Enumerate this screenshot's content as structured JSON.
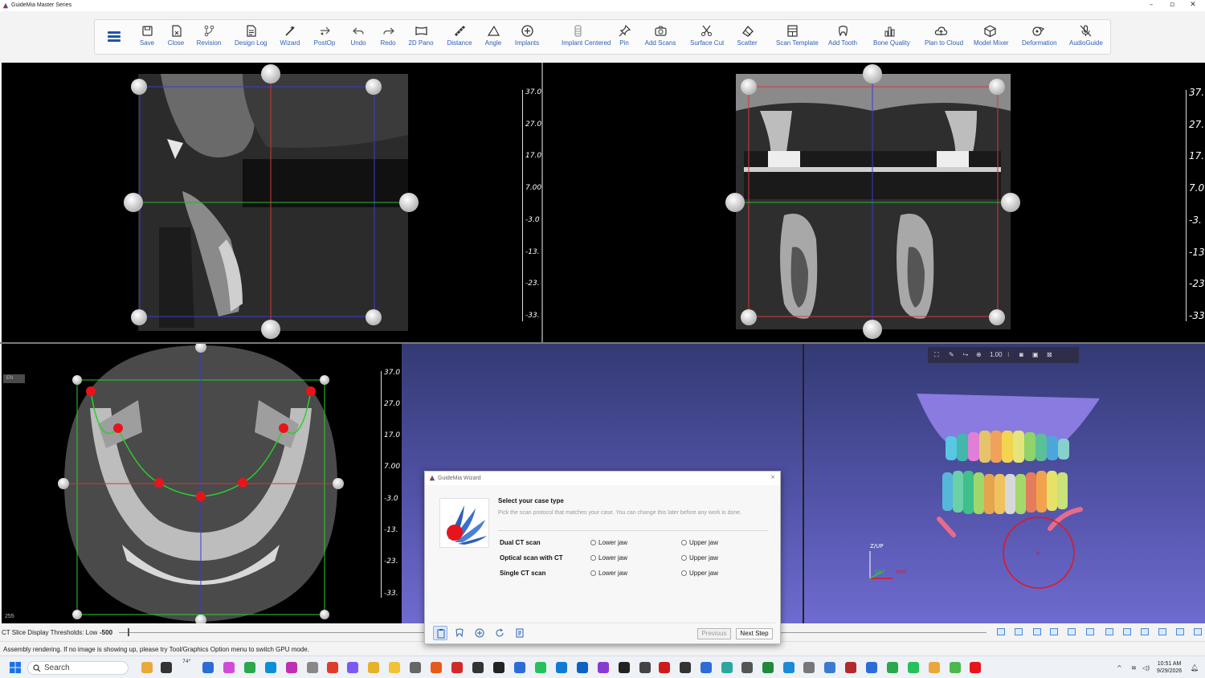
{
  "window": {
    "title": "GuideMia Master Series",
    "controls": [
      "–",
      "▫",
      "✕"
    ]
  },
  "toolbar": {
    "items": [
      {
        "label": "Save",
        "icon": "save-icon"
      },
      {
        "label": "Close",
        "icon": "close-file-icon"
      },
      {
        "label": "Revision",
        "icon": "revision-icon"
      },
      {
        "label": "Design Log",
        "icon": "design-log-icon"
      },
      {
        "label": "Wizard",
        "icon": "wizard-icon"
      },
      {
        "label": "PostOp",
        "icon": "postop-icon"
      },
      {
        "label": "Undo",
        "icon": "undo-icon"
      },
      {
        "label": "Redo",
        "icon": "redo-icon"
      },
      {
        "label": "2D Pano",
        "icon": "pano-icon"
      },
      {
        "label": "Distance",
        "icon": "distance-icon"
      },
      {
        "label": "Angle",
        "icon": "angle-icon"
      },
      {
        "label": "Implants",
        "icon": "implants-icon"
      },
      {
        "label": "Implant Centered",
        "icon": "implant-centered-icon"
      },
      {
        "label": "Pin",
        "icon": "pin-icon"
      },
      {
        "label": "Add Scans",
        "icon": "add-scans-icon"
      },
      {
        "label": "Surface Cut",
        "icon": "surface-cut-icon"
      },
      {
        "label": "Scatter",
        "icon": "scatter-icon"
      },
      {
        "label": "Scan Template",
        "icon": "scan-template-icon"
      },
      {
        "label": "Add Tooth",
        "icon": "add-tooth-icon"
      },
      {
        "label": "Bone Quality",
        "icon": "bone-quality-icon"
      },
      {
        "label": "Plan to Cloud",
        "icon": "cloud-icon"
      },
      {
        "label": "Model Mixer",
        "icon": "model-mixer-icon"
      },
      {
        "label": "Deformation",
        "icon": "deformation-icon"
      },
      {
        "label": "AudioGuide",
        "icon": "audioguide-icon"
      }
    ]
  },
  "viewports": {
    "scale_ticks": [
      "37.0",
      "27.0",
      "17.0",
      "7.00",
      "-3.0",
      "-13.",
      "-23.",
      "-33."
    ],
    "scale_ticks_right": [
      "37.",
      "27.",
      "17.",
      "7.0",
      "-3.",
      "-13",
      "-23",
      "-33"
    ],
    "lang_badge": "EN",
    "corner_value": "255",
    "view3d": {
      "toolbar_zoom": "1.00",
      "axis_up": "Z/UP",
      "axis_right": "X/RT",
      "axis_left": "Y/LF"
    }
  },
  "threshold": {
    "label": "CT Slice Display Thresholds: Low",
    "value": "-500"
  },
  "status": {
    "message": "Assembly rendering. If no image is showing up, please try Tool/Graphics Option menu to switch GPU mode."
  },
  "dialog": {
    "title": "GuideMia Wizard",
    "heading": "Select your case type",
    "description": "Pick the scan protocol that matches your case. You can change this later before any work is done.",
    "options": [
      {
        "name": "Dual CT scan",
        "lower": "Lower jaw",
        "upper": "Upper jaw"
      },
      {
        "name": "Optical scan with CT",
        "lower": "Lower jaw",
        "upper": "Upper jaw"
      },
      {
        "name": "Single CT scan",
        "lower": "Lower jaw",
        "upper": "Upper jaw"
      }
    ],
    "previous": "Previous",
    "next": "Next Step"
  },
  "taskbar": {
    "search_placeholder": "Search",
    "weather": "74°",
    "time": "10:51 AM",
    "date": "9/29/2026"
  },
  "colors": {
    "accent": "#2d5fb5",
    "marker_red": "#e8141c",
    "curve_green": "#2ad12a"
  }
}
